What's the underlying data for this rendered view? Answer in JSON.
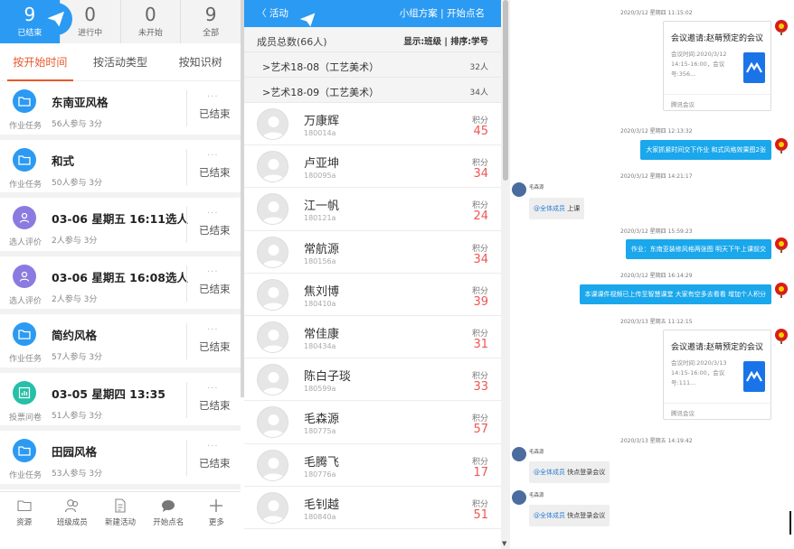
{
  "stats": [
    {
      "num": "9",
      "label": "已结束"
    },
    {
      "num": "0",
      "label": "进行中"
    },
    {
      "num": "0",
      "label": "未开始"
    },
    {
      "num": "9",
      "label": "全部"
    }
  ],
  "filters": [
    "按开始时间",
    "按活动类型",
    "按知识树"
  ],
  "activities": [
    {
      "title": "东南亚风格",
      "type": "作业任务",
      "meta": "56人参与   3分",
      "state": "已结束",
      "icon": "folder-icon",
      "color": "#2b9af3"
    },
    {
      "title": "和式",
      "type": "作业任务",
      "meta": "50人参与   3分",
      "state": "已结束",
      "icon": "folder-icon",
      "color": "#2b9af3"
    },
    {
      "title": "03-06 星期五 16:11选人",
      "type": "选人评价",
      "meta": "2人参与   3分",
      "state": "已结束",
      "icon": "person-icon",
      "color": "#8b7be0"
    },
    {
      "title": "03-06 星期五 16:08选人",
      "type": "选人评价",
      "meta": "2人参与   3分",
      "state": "已结束",
      "icon": "person-icon",
      "color": "#8b7be0"
    },
    {
      "title": "简约风格",
      "type": "作业任务",
      "meta": "57人参与   3分",
      "state": "已结束",
      "icon": "folder-icon",
      "color": "#2b9af3"
    },
    {
      "title": "03-05 星期四 13:35",
      "type": "投票问卷",
      "meta": "51人参与   3分",
      "state": "已结束",
      "icon": "chart-icon",
      "color": "#26c0a7"
    },
    {
      "title": "田园风格",
      "type": "作业任务",
      "meta": "53人参与   3分",
      "state": "已结束",
      "icon": "folder-icon",
      "color": "#2b9af3"
    }
  ],
  "bottom_nav": [
    {
      "label": "资源",
      "icon": "folder-outline-icon"
    },
    {
      "label": "班级成员",
      "icon": "members-icon"
    },
    {
      "label": "新建活动",
      "icon": "document-icon"
    },
    {
      "label": "开始点名",
      "icon": "chat-bubble-icon"
    },
    {
      "label": "更多",
      "icon": "plus-icon"
    }
  ],
  "panel2": {
    "back_label": "活动",
    "header_right": "小组方案  |  开始点名",
    "summary_left": "成员总数(66人)",
    "summary_right": "显示:班级  |  排序:学号",
    "groups": [
      {
        "name": ">艺术18-08（工艺美术）",
        "count": "32人"
      },
      {
        "name": ">艺术18-09（工艺美术）",
        "count": "34人"
      }
    ],
    "points_label": "积分",
    "members": [
      {
        "name": "万康辉",
        "id": "180014a",
        "points": "45"
      },
      {
        "name": "卢亚坤",
        "id": "180095a",
        "points": "34"
      },
      {
        "name": "江一帆",
        "id": "180121a",
        "points": "24"
      },
      {
        "name": "常航源",
        "id": "180156a",
        "points": "34"
      },
      {
        "name": "焦刘博",
        "id": "180410a",
        "points": "39"
      },
      {
        "name": "常佳康",
        "id": "180434a",
        "points": "31"
      },
      {
        "name": "陈白子琰",
        "id": "180599a",
        "points": "33"
      },
      {
        "name": "毛森源",
        "id": "180775a",
        "points": "57"
      },
      {
        "name": "毛腾飞",
        "id": "180776a",
        "points": "17"
      },
      {
        "name": "毛钊越",
        "id": "180840a",
        "points": "51"
      }
    ]
  },
  "chat": {
    "ts1": "2020/3/12 星期四 11:15:02",
    "card1": {
      "title": "会议邀请:赵萌预定的会议",
      "detail": "会议时间:2020/3/12 14:15-16:00，会议号:356...",
      "footer": "腾讯会议"
    },
    "ts2": "2020/3/12 星期四 12:13:32",
    "msg2": "大家抓紧时间交下作业 和式风格效果图2张",
    "ts3": "2020/3/12 星期四 14:21:17",
    "sender": "毛森源",
    "msg3_at": "@全体成员",
    "msg3": " 上课",
    "ts4": "2020/3/12 星期四 15:59:23",
    "msg4": "作业：东南亚装修风格两张图 明天下午上课前交",
    "ts5": "2020/3/12 星期四 16:14:29",
    "msg5": "本课课件视频已上传至智慧课堂 大家有空多去看看 增加个人积分",
    "ts6": "2020/3/13 星期五 11:12:15",
    "card2": {
      "title": "会议邀请:赵萌预定的会议",
      "detail": "会议时间:2020/3/13 14:15-16:00，会议号:111...",
      "footer": "腾讯会议"
    },
    "ts7": "2020/3/13 星期五 14:19:42",
    "msg7_at": "@全体成员",
    "msg7": " 快点登录会议",
    "msg8_at": "@全体成员",
    "msg8": " 快点登录会议"
  }
}
